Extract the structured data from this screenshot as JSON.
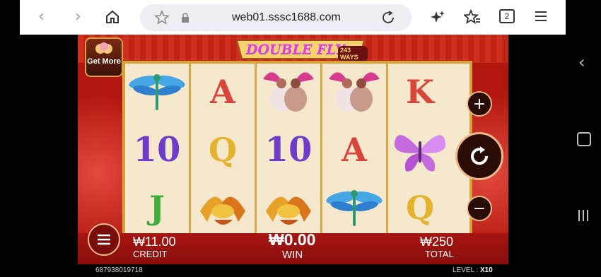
{
  "browser": {
    "url": "web01.sssc1688.com",
    "tab_count": "2",
    "back_icon": "‹",
    "forward_icon": "›"
  },
  "game": {
    "title": "DOUBLE FLY",
    "ways": "243 WAYS",
    "get_more": "Get More",
    "reels": [
      [
        "dragonfly",
        "10",
        "J"
      ],
      [
        "A",
        "Q",
        "bird-pair-gold"
      ],
      [
        "bird-pair-pink",
        "10",
        "bird-pair-gold"
      ],
      [
        "bird-pair-pink",
        "A",
        "dragonfly"
      ],
      [
        "K",
        "butterfly",
        "Q"
      ]
    ],
    "credit_value": "₩11.00",
    "credit_label": "CREDIT",
    "win_value": "₩0.00",
    "win_label": "WIN",
    "total_value": "₩250",
    "total_label": "TOTAL",
    "account_id": "687938019718",
    "level_label": "LEVEL :",
    "level_value": "X10"
  },
  "colors": {
    "letter_red": "#d8453a",
    "letter_gold": "#e5b22e",
    "letter_green": "#3fae3a",
    "letter_purple": "#6e3cc9"
  }
}
